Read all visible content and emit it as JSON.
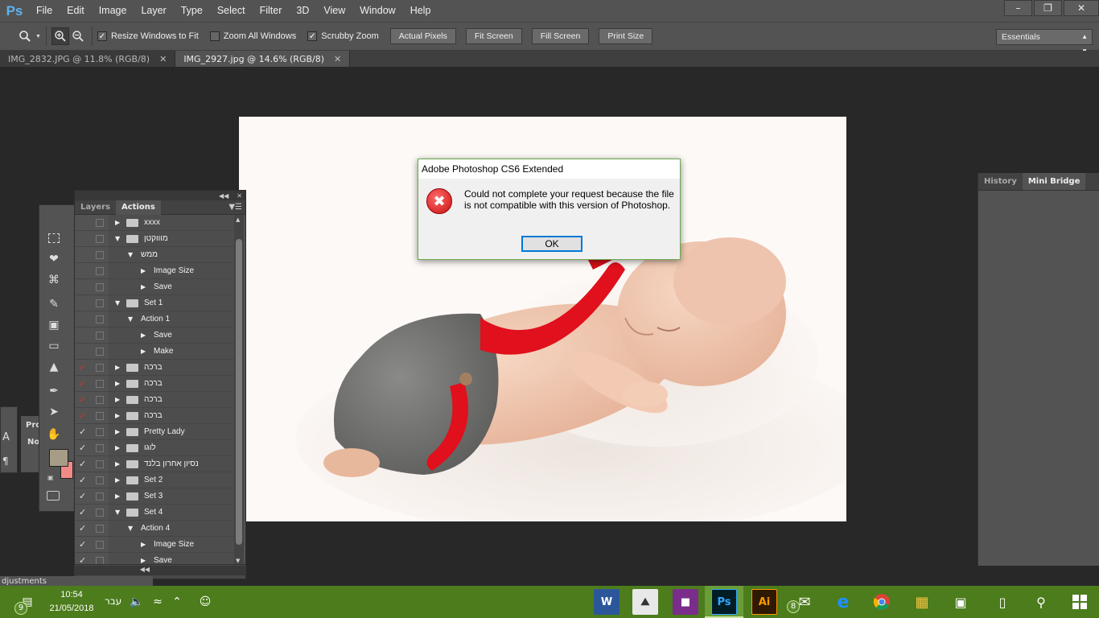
{
  "app": {
    "logo": "Ps"
  },
  "menu": [
    "File",
    "Edit",
    "Image",
    "Layer",
    "Type",
    "Select",
    "Filter",
    "3D",
    "View",
    "Window",
    "Help"
  ],
  "options_bar": {
    "checkboxes": [
      {
        "label": "Resize Windows to Fit",
        "checked": true
      },
      {
        "label": "Zoom All Windows",
        "checked": false
      },
      {
        "label": "Scrubby Zoom",
        "checked": true
      }
    ],
    "buttons": [
      "Actual Pixels",
      "Fit Screen",
      "Fill Screen",
      "Print Size"
    ],
    "workspace": "Essentials"
  },
  "tabs": [
    {
      "label": "IMG_2832.JPG @ 11.8% (RGB/8)",
      "active": false
    },
    {
      "label": "IMG_2927.jpg @ 14.6% (RGB/8)",
      "active": true
    }
  ],
  "right_panel": {
    "tabs": [
      "History",
      "Mini Bridge"
    ],
    "active": "Mini Bridge"
  },
  "actions_panel": {
    "tabs": [
      "Layers",
      "Actions"
    ],
    "active": "Actions",
    "rows": [
      {
        "tick": "",
        "indent": 0,
        "expanded": false,
        "folder": true,
        "label": "xxxx"
      },
      {
        "tick": "",
        "indent": 0,
        "expanded": true,
        "folder": true,
        "label": "מוווקטן"
      },
      {
        "tick": "",
        "indent": 1,
        "expanded": true,
        "folder": false,
        "label": "ממש"
      },
      {
        "tick": "",
        "indent": 2,
        "expanded": false,
        "folder": false,
        "label": "Image Size"
      },
      {
        "tick": "",
        "indent": 2,
        "expanded": false,
        "folder": false,
        "label": "Save"
      },
      {
        "tick": "",
        "indent": 0,
        "expanded": true,
        "folder": true,
        "label": "Set 1"
      },
      {
        "tick": "",
        "indent": 1,
        "expanded": true,
        "folder": false,
        "label": "Action 1"
      },
      {
        "tick": "",
        "indent": 2,
        "expanded": false,
        "folder": false,
        "label": "Save"
      },
      {
        "tick": "",
        "indent": 2,
        "expanded": false,
        "folder": false,
        "label": "Make"
      },
      {
        "tick": "red",
        "indent": 0,
        "expanded": false,
        "folder": true,
        "label": "ברכה"
      },
      {
        "tick": "red",
        "indent": 0,
        "expanded": false,
        "folder": true,
        "label": "ברכה"
      },
      {
        "tick": "red",
        "indent": 0,
        "expanded": false,
        "folder": true,
        "label": "ברכה"
      },
      {
        "tick": "red",
        "indent": 0,
        "expanded": false,
        "folder": true,
        "label": "ברכה"
      },
      {
        "tick": "white",
        "indent": 0,
        "expanded": false,
        "folder": true,
        "label": "Pretty Lady"
      },
      {
        "tick": "white",
        "indent": 0,
        "expanded": false,
        "folder": true,
        "label": "לוגו"
      },
      {
        "tick": "white",
        "indent": 0,
        "expanded": false,
        "folder": true,
        "label": "נסיון אחרון בלנד"
      },
      {
        "tick": "white",
        "indent": 0,
        "expanded": false,
        "folder": true,
        "label": "Set 2"
      },
      {
        "tick": "white",
        "indent": 0,
        "expanded": false,
        "folder": true,
        "label": "Set 3"
      },
      {
        "tick": "white",
        "indent": 0,
        "expanded": true,
        "folder": true,
        "label": "Set 4"
      },
      {
        "tick": "white",
        "indent": 1,
        "expanded": true,
        "folder": false,
        "label": "Action 4"
      },
      {
        "tick": "white",
        "indent": 2,
        "expanded": false,
        "folder": false,
        "label": "Image Size"
      },
      {
        "tick": "white",
        "indent": 2,
        "expanded": false,
        "folder": false,
        "label": "Save"
      }
    ]
  },
  "left_fragments": {
    "properties_tab": "Pro",
    "properties_text": "No",
    "adjustments_label": "djustments"
  },
  "dialog": {
    "title": "Adobe Photoshop CS6 Extended",
    "message": "Could not complete your request because the file is not compatible with this version of Photoshop.",
    "ok_label": "OK"
  },
  "taskbar": {
    "time": "10:54",
    "date": "21/05/2018",
    "language": "עבר",
    "notification_count": "9",
    "mail_count": "8"
  },
  "colors": {
    "foreground_swatch": "#a79d86",
    "background_swatch": "#f08a86",
    "taskbar": "#4c7c1c",
    "suspender_red": "#e0101c"
  }
}
